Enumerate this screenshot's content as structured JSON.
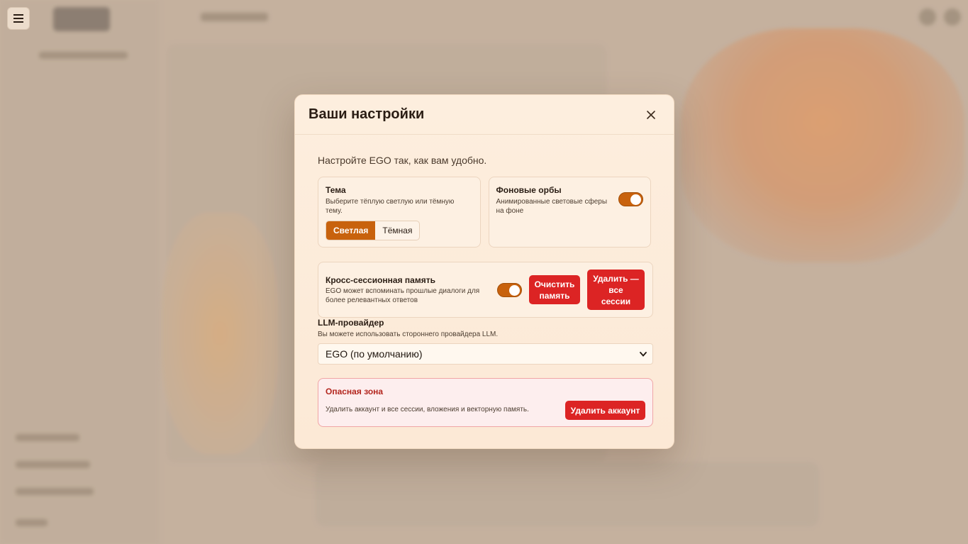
{
  "modal": {
    "title": "Ваши настройки",
    "close_icon": "close-icon",
    "intro": "Настройте EGO так, как вам удобно."
  },
  "theme": {
    "title": "Тема",
    "description": "Выберите тёплую светлую или тёмную тему.",
    "options": [
      "Светлая",
      "Тёмная"
    ],
    "selected": "Светлая"
  },
  "orbs": {
    "title": "Фоновые орбы",
    "description": "Анимированные световые сферы на фоне",
    "enabled": true
  },
  "memory": {
    "title": "Кросс-сессионная память",
    "description": "EGO может вспоминать прошлые диалоги для более релевантных ответов",
    "enabled": true,
    "clear_label": "Очистить память",
    "delete_all_label": "Удалить — все сессии"
  },
  "llm": {
    "title": "LLM-провайдер",
    "description": "Вы можете использовать стороннего провайдера LLM.",
    "selected": "EGO (по умолчанию)"
  },
  "danger": {
    "title": "Опасная зона",
    "description": "Удалить аккаунт и все сессии, вложения и векторную память.",
    "delete_account_label": "Удалить аккаунт"
  },
  "colors": {
    "accent": "#c8620d",
    "danger": "#dc2424",
    "modal_bg": "#fdeede"
  },
  "icons": {
    "menu": "hamburger-menu-icon",
    "close": "close-icon",
    "select": "chevron-down-icon"
  }
}
